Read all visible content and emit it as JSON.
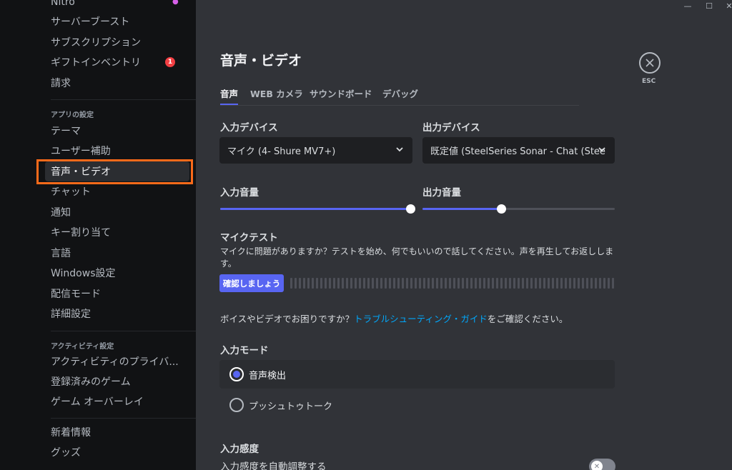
{
  "window": {
    "minimize": "—",
    "maximize": "☐",
    "close": "✕"
  },
  "sidebar": {
    "top_items": [
      {
        "label": "Nitro"
      },
      {
        "label": "サーバーブースト"
      },
      {
        "label": "サブスクリプション"
      },
      {
        "label": "ギフトインベントリ",
        "badge": "1"
      },
      {
        "label": "請求"
      }
    ],
    "app_header": "アプリの設定",
    "app_items": [
      {
        "label": "テーマ"
      },
      {
        "label": "ユーザー補助"
      },
      {
        "label": "音声・ビデオ"
      },
      {
        "label": "チャット"
      },
      {
        "label": "通知"
      },
      {
        "label": "キー割り当て"
      },
      {
        "label": "言語"
      },
      {
        "label": "Windows設定"
      },
      {
        "label": "配信モード"
      },
      {
        "label": "詳細設定"
      }
    ],
    "activity_header": "アクティビティ設定",
    "activity_items": [
      {
        "label": "アクティビティのプライバ..."
      },
      {
        "label": "登録済みのゲーム"
      },
      {
        "label": "ゲーム オーバーレイ"
      }
    ],
    "bottom_items": [
      {
        "label": "新着情報"
      },
      {
        "label": "グッズ"
      }
    ]
  },
  "main": {
    "title": "音声・ビデオ",
    "tabs": [
      {
        "label": "音声"
      },
      {
        "label": "WEB カメラ"
      },
      {
        "label": "サウンドボード"
      },
      {
        "label": "デバッグ"
      }
    ],
    "input_device": {
      "label": "入力デバイス",
      "value": "マイク (4- Shure MV7+)"
    },
    "output_device": {
      "label": "出力デバイス",
      "value": "既定値 (SteelSeries Sonar - Chat (Stee"
    },
    "input_volume": {
      "label": "入力音量",
      "value": 100
    },
    "output_volume": {
      "label": "出力音量",
      "value": 41
    },
    "mic_test": {
      "title": "マイクテスト",
      "description": "マイクに問題がありますか？テストを始め、何でもいいので話してください。声を再生してお返しします。",
      "button": "確認しましょう"
    },
    "troubleshoot": {
      "prefix": "ボイスやビデオでお困りですか？",
      "link": "トラブルシューティング・ガイド",
      "suffix": "をご確認ください。"
    },
    "input_mode": {
      "label": "入力モード",
      "options": [
        {
          "label": "音声検出",
          "selected": true
        },
        {
          "label": "プッシュトゥトーク",
          "selected": false
        }
      ]
    },
    "sensitivity": {
      "label": "入力感度",
      "auto_label": "入力感度を自動調整する",
      "enabled": false
    },
    "esc": "ESC"
  },
  "colors": {
    "accent": "#5865f2",
    "highlight": "#fa6a1a",
    "link": "#00a8fc",
    "badge": "#f23f43"
  }
}
